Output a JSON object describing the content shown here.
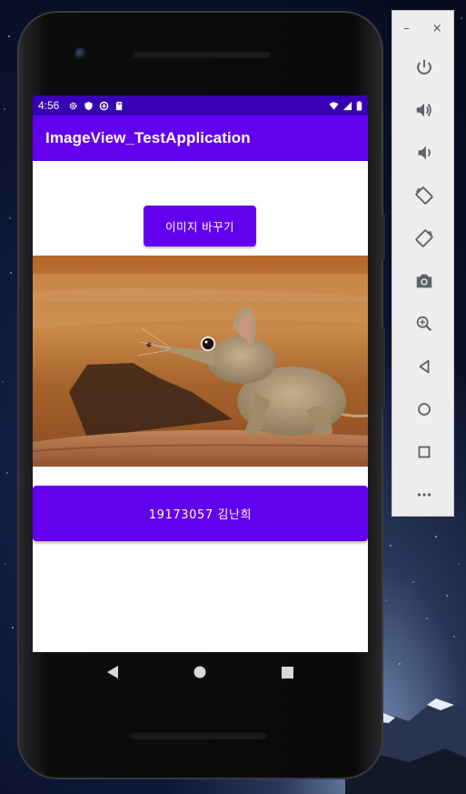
{
  "status_bar": {
    "time": "4:56"
  },
  "app_bar": {
    "title": "ImageView_TestApplication"
  },
  "buttons": {
    "change_image": "이미지 바꾸기",
    "student_info": "19173057 김난희"
  },
  "emulator_panel": {
    "minimize": "–",
    "close": "×",
    "tools": [
      "power",
      "volume-up",
      "volume-down",
      "rotate-left",
      "rotate-right",
      "screenshot",
      "zoom",
      "back",
      "home",
      "overview",
      "more"
    ]
  },
  "colors": {
    "primary": "#6200ee",
    "primary_dark": "#3700b3"
  }
}
